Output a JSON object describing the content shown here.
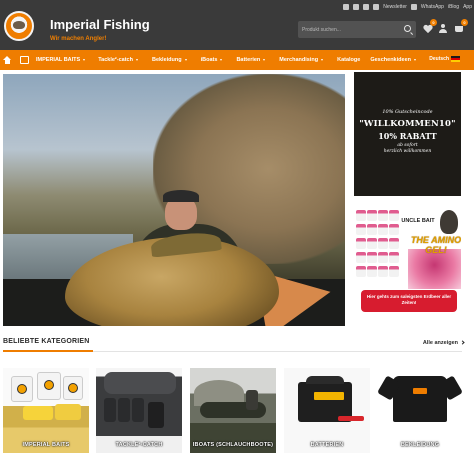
{
  "header": {
    "brand_title": "Imperial Fishing",
    "brand_subtitle": "Wir machen Angler!",
    "top_links": [
      {
        "icon": "facebook-icon"
      },
      {
        "icon": "instagram-icon"
      },
      {
        "icon": "youtube-icon"
      },
      {
        "icon": "newsletter-icon",
        "label": "Newsletter"
      },
      {
        "icon": "whatsapp-icon",
        "label": "WhatsApp"
      },
      {
        "label": "iBlog"
      },
      {
        "label": "App"
      }
    ],
    "search": {
      "placeholder": "Produkt suchen..."
    },
    "wishlist_count": "0",
    "cart_count": "0",
    "colors": {
      "header_bg": "#3a3a3a",
      "accent": "#ef7d00"
    }
  },
  "nav": {
    "items": [
      {
        "label": "IMPERIAL BAITS",
        "has_dropdown": true
      },
      {
        "label": "Tackle²-catch",
        "has_dropdown": true
      },
      {
        "label": "Bekleidung",
        "has_dropdown": true
      },
      {
        "label": "iBoats",
        "has_dropdown": true
      },
      {
        "label": "Batterien",
        "has_dropdown": true
      },
      {
        "label": "Merchandising",
        "has_dropdown": true
      },
      {
        "label": "Kataloge",
        "has_dropdown": false
      },
      {
        "label": "Geschenkideen",
        "has_dropdown": true
      }
    ],
    "language": "Deutsch"
  },
  "promo_top": {
    "line1": "10% Gutscheincode",
    "line2": "\"WILLKOMMEN10\"",
    "line3": "10% RABATT",
    "line4": "ab sofort",
    "line5": "herzlich willkommen"
  },
  "promo_bottom": {
    "brand": "UNCLE BAIT",
    "product": "THE AMINO GEL!",
    "banner": "Hier gehts zum saleigsten Erdbeer aller Zeiten!"
  },
  "categories": {
    "title": "BELIEBTE KATEGORIEN",
    "all_link": "Alle anzeigen",
    "items": [
      {
        "label": "IMPERIAL BAITS"
      },
      {
        "label": "TACKLE²-CATCH"
      },
      {
        "label": "IBOATS (SCHLAUCHBOOTE)"
      },
      {
        "label": "BATTERIEN"
      },
      {
        "label": "BEKLEIDUNG"
      }
    ]
  }
}
